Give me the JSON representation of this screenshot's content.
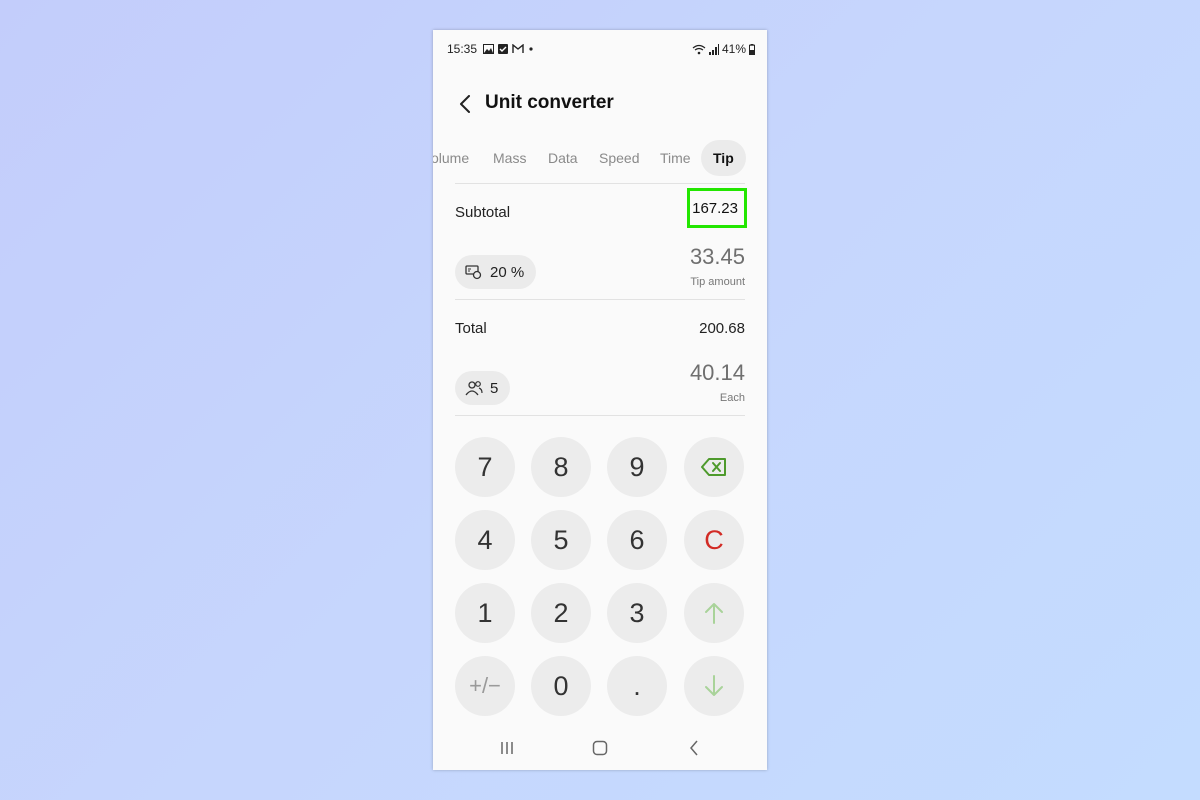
{
  "status_bar": {
    "time": "15:35",
    "battery": "41%"
  },
  "header": {
    "title": "Unit converter"
  },
  "tabs": [
    {
      "label": "olume"
    },
    {
      "label": "Mass"
    },
    {
      "label": "Data"
    },
    {
      "label": "Speed"
    },
    {
      "label": "Time"
    },
    {
      "label": "Tip",
      "active": true
    }
  ],
  "subtotal": {
    "label": "Subtotal",
    "value": "167.23"
  },
  "tip": {
    "percent": "20 %",
    "amount": "33.45",
    "amount_caption": "Tip amount"
  },
  "total": {
    "label": "Total",
    "value": "200.68"
  },
  "split": {
    "people": "5",
    "each": "40.14",
    "each_caption": "Each"
  },
  "keypad": {
    "k7": "7",
    "k8": "8",
    "k9": "9",
    "k4": "4",
    "k5": "5",
    "k6": "6",
    "k1": "1",
    "k2": "2",
    "k3": "3",
    "plusminus": "+/−",
    "k0": "0",
    "dot": ".",
    "clear": "C"
  },
  "colors": {
    "highlight": "#23e600",
    "clear": "#d22b25",
    "backspace": "#4e9a2c",
    "arrow": "#a9d39a"
  },
  "icons": [
    "back-arrow-icon",
    "backspace-icon",
    "arrow-up-icon",
    "arrow-down-icon",
    "tip-icon",
    "people-icon",
    "recent-apps-icon",
    "home-icon",
    "nav-back-icon"
  ]
}
